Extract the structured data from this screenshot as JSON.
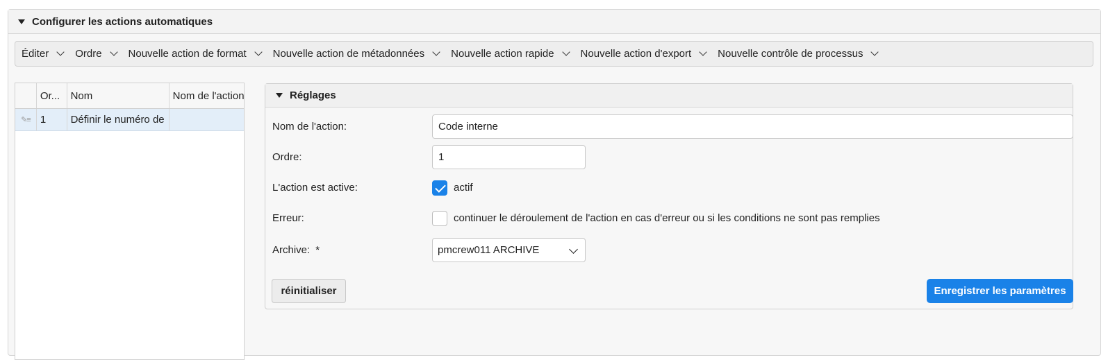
{
  "panel": {
    "title": "Configurer les actions automatiques"
  },
  "toolbar": {
    "items": [
      {
        "label": "Éditer"
      },
      {
        "label": "Ordre"
      },
      {
        "label": "Nouvelle action de format"
      },
      {
        "label": "Nouvelle action de métadonnées"
      },
      {
        "label": "Nouvelle action rapide"
      },
      {
        "label": "Nouvelle action d'export"
      },
      {
        "label": "Nouvelle contrôle de processus"
      }
    ]
  },
  "list": {
    "columns": [
      "Or...",
      "Nom",
      "Nom de l'action"
    ],
    "rows": [
      {
        "order": "1",
        "name": "Définir le numéro de",
        "action_name": ""
      }
    ]
  },
  "settings": {
    "title": "Réglages",
    "action_name_label": "Nom de l'action:",
    "action_name_value": "Code interne",
    "order_label": "Ordre:",
    "order_value": "1",
    "active_label": "L'action est active:",
    "active_checkbox_label": "actif",
    "active_checked": true,
    "error_label": "Erreur:",
    "error_checkbox_label": "continuer le déroulement de l'action en cas d'erreur ou si les conditions ne sont pas remplies",
    "error_checked": false,
    "archive_label": "Archive:",
    "archive_required_mark": "*",
    "archive_value": "pmcrew011 ARCHIVE",
    "reset_label": "réinitialiser",
    "save_label": "Enregistrer les paramètres"
  },
  "colors": {
    "accent": "#1a82e8",
    "row_selected": "#e3eef9"
  }
}
